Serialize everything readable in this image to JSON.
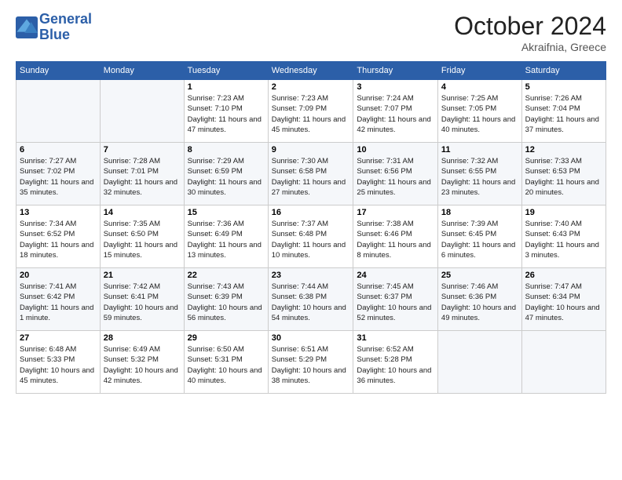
{
  "header": {
    "logo_line1": "General",
    "logo_line2": "Blue",
    "month": "October 2024",
    "location": "Akraifnia, Greece"
  },
  "weekdays": [
    "Sunday",
    "Monday",
    "Tuesday",
    "Wednesday",
    "Thursday",
    "Friday",
    "Saturday"
  ],
  "weeks": [
    [
      {
        "day": "",
        "info": ""
      },
      {
        "day": "",
        "info": ""
      },
      {
        "day": "1",
        "info": "Sunrise: 7:23 AM\nSunset: 7:10 PM\nDaylight: 11 hours and 47 minutes."
      },
      {
        "day": "2",
        "info": "Sunrise: 7:23 AM\nSunset: 7:09 PM\nDaylight: 11 hours and 45 minutes."
      },
      {
        "day": "3",
        "info": "Sunrise: 7:24 AM\nSunset: 7:07 PM\nDaylight: 11 hours and 42 minutes."
      },
      {
        "day": "4",
        "info": "Sunrise: 7:25 AM\nSunset: 7:05 PM\nDaylight: 11 hours and 40 minutes."
      },
      {
        "day": "5",
        "info": "Sunrise: 7:26 AM\nSunset: 7:04 PM\nDaylight: 11 hours and 37 minutes."
      }
    ],
    [
      {
        "day": "6",
        "info": "Sunrise: 7:27 AM\nSunset: 7:02 PM\nDaylight: 11 hours and 35 minutes."
      },
      {
        "day": "7",
        "info": "Sunrise: 7:28 AM\nSunset: 7:01 PM\nDaylight: 11 hours and 32 minutes."
      },
      {
        "day": "8",
        "info": "Sunrise: 7:29 AM\nSunset: 6:59 PM\nDaylight: 11 hours and 30 minutes."
      },
      {
        "day": "9",
        "info": "Sunrise: 7:30 AM\nSunset: 6:58 PM\nDaylight: 11 hours and 27 minutes."
      },
      {
        "day": "10",
        "info": "Sunrise: 7:31 AM\nSunset: 6:56 PM\nDaylight: 11 hours and 25 minutes."
      },
      {
        "day": "11",
        "info": "Sunrise: 7:32 AM\nSunset: 6:55 PM\nDaylight: 11 hours and 23 minutes."
      },
      {
        "day": "12",
        "info": "Sunrise: 7:33 AM\nSunset: 6:53 PM\nDaylight: 11 hours and 20 minutes."
      }
    ],
    [
      {
        "day": "13",
        "info": "Sunrise: 7:34 AM\nSunset: 6:52 PM\nDaylight: 11 hours and 18 minutes."
      },
      {
        "day": "14",
        "info": "Sunrise: 7:35 AM\nSunset: 6:50 PM\nDaylight: 11 hours and 15 minutes."
      },
      {
        "day": "15",
        "info": "Sunrise: 7:36 AM\nSunset: 6:49 PM\nDaylight: 11 hours and 13 minutes."
      },
      {
        "day": "16",
        "info": "Sunrise: 7:37 AM\nSunset: 6:48 PM\nDaylight: 11 hours and 10 minutes."
      },
      {
        "day": "17",
        "info": "Sunrise: 7:38 AM\nSunset: 6:46 PM\nDaylight: 11 hours and 8 minutes."
      },
      {
        "day": "18",
        "info": "Sunrise: 7:39 AM\nSunset: 6:45 PM\nDaylight: 11 hours and 6 minutes."
      },
      {
        "day": "19",
        "info": "Sunrise: 7:40 AM\nSunset: 6:43 PM\nDaylight: 11 hours and 3 minutes."
      }
    ],
    [
      {
        "day": "20",
        "info": "Sunrise: 7:41 AM\nSunset: 6:42 PM\nDaylight: 11 hours and 1 minute."
      },
      {
        "day": "21",
        "info": "Sunrise: 7:42 AM\nSunset: 6:41 PM\nDaylight: 10 hours and 59 minutes."
      },
      {
        "day": "22",
        "info": "Sunrise: 7:43 AM\nSunset: 6:39 PM\nDaylight: 10 hours and 56 minutes."
      },
      {
        "day": "23",
        "info": "Sunrise: 7:44 AM\nSunset: 6:38 PM\nDaylight: 10 hours and 54 minutes."
      },
      {
        "day": "24",
        "info": "Sunrise: 7:45 AM\nSunset: 6:37 PM\nDaylight: 10 hours and 52 minutes."
      },
      {
        "day": "25",
        "info": "Sunrise: 7:46 AM\nSunset: 6:36 PM\nDaylight: 10 hours and 49 minutes."
      },
      {
        "day": "26",
        "info": "Sunrise: 7:47 AM\nSunset: 6:34 PM\nDaylight: 10 hours and 47 minutes."
      }
    ],
    [
      {
        "day": "27",
        "info": "Sunrise: 6:48 AM\nSunset: 5:33 PM\nDaylight: 10 hours and 45 minutes."
      },
      {
        "day": "28",
        "info": "Sunrise: 6:49 AM\nSunset: 5:32 PM\nDaylight: 10 hours and 42 minutes."
      },
      {
        "day": "29",
        "info": "Sunrise: 6:50 AM\nSunset: 5:31 PM\nDaylight: 10 hours and 40 minutes."
      },
      {
        "day": "30",
        "info": "Sunrise: 6:51 AM\nSunset: 5:29 PM\nDaylight: 10 hours and 38 minutes."
      },
      {
        "day": "31",
        "info": "Sunrise: 6:52 AM\nSunset: 5:28 PM\nDaylight: 10 hours and 36 minutes."
      },
      {
        "day": "",
        "info": ""
      },
      {
        "day": "",
        "info": ""
      }
    ]
  ]
}
